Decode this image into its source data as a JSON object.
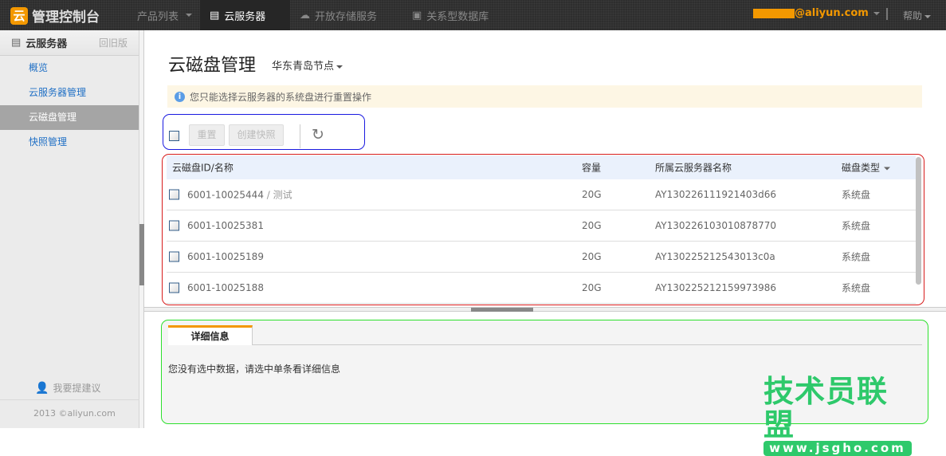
{
  "topbar": {
    "logo": "管理控制台",
    "logo_mark": "云",
    "nav": [
      {
        "label": "产品列表",
        "icon": "caret-down"
      },
      {
        "label": "云服务器",
        "icon": "server-icon",
        "active": true
      },
      {
        "label": "开放存储服务",
        "icon": "cloud-storage-icon"
      },
      {
        "label": "关系型数据库",
        "icon": "database-icon"
      }
    ],
    "user_email_visible": "@aliyun.com",
    "help": "帮助"
  },
  "sidebar": {
    "title": "云服务器",
    "old_version": "回旧版",
    "items": [
      {
        "label": "概览"
      },
      {
        "label": "云服务器管理"
      },
      {
        "label": "云磁盘管理",
        "active": true
      },
      {
        "label": "快照管理"
      }
    ],
    "suggest": "我要提建议",
    "copyright": "2013 ©aliyun.com"
  },
  "main": {
    "title": "云磁盘管理",
    "region": "华东青岛节点",
    "notice": "您只能选择云服务器的系统盘进行重置操作",
    "toolbar": {
      "reset": "重置",
      "snapshot": "创建快照"
    },
    "table": {
      "columns": [
        "云磁盘ID/名称",
        "容量",
        "所属云服务器名称",
        "磁盘类型"
      ],
      "rows": [
        {
          "id": "6001-10025444",
          "name": " / 测试",
          "size": "20G",
          "server": "AY130226111921403d66",
          "type": "系统盘"
        },
        {
          "id": "6001-10025381",
          "name": "",
          "size": "20G",
          "server": "AY130226103010878770",
          "type": "系统盘"
        },
        {
          "id": "6001-10025189",
          "name": "",
          "size": "20G",
          "server": "AY130225212543013c0a",
          "type": "系统盘"
        },
        {
          "id": "6001-10025188",
          "name": "",
          "size": "20G",
          "server": "AY130225212159973986",
          "type": "系统盘"
        }
      ]
    }
  },
  "detail": {
    "tab": "详细信息",
    "empty": "您没有选中数据，请选中单条看详细信息"
  },
  "watermark": {
    "text": "技术员联盟",
    "url": "www.jsgho.com"
  },
  "colors": {
    "accent": "#f39800",
    "link": "#1f6fc5",
    "watermark": "#2ec96b"
  }
}
